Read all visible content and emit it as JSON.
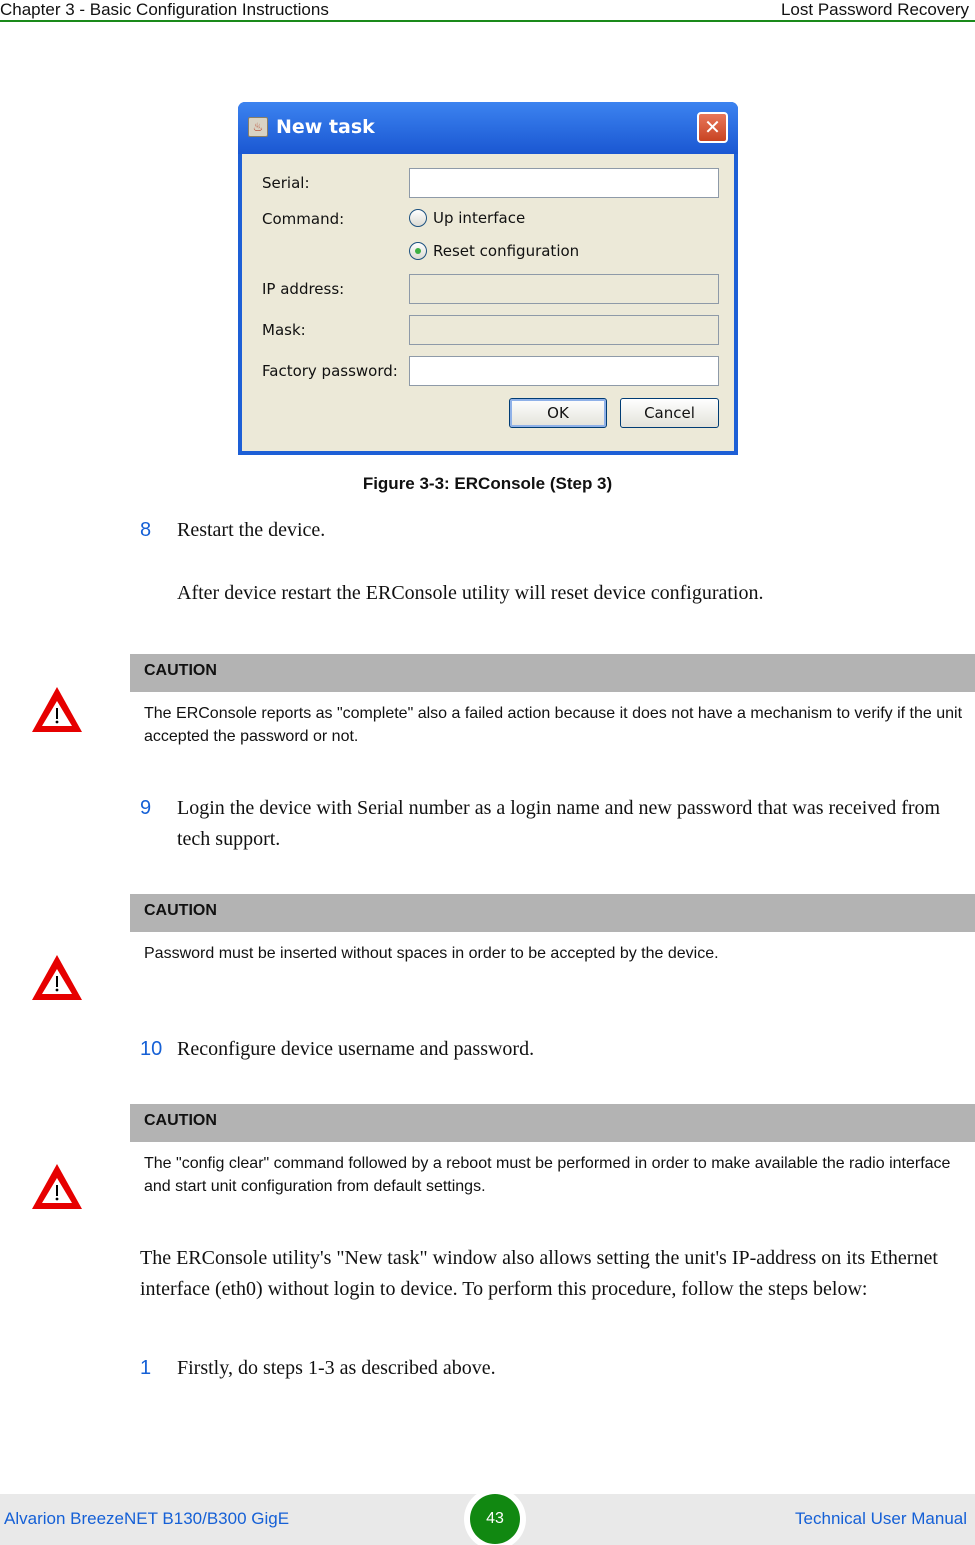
{
  "header": {
    "chapter": "Chapter 3 - Basic Configuration Instructions",
    "section": "Lost Password Recovery"
  },
  "dialog": {
    "title": "New task",
    "close_glyph": "✕",
    "app_icon_glyph": "♨",
    "fields": {
      "serial_label": "Serial:",
      "serial_value": "",
      "command_label": "Command:",
      "ip_label": "IP address:",
      "ip_value": "",
      "mask_label": "Mask:",
      "mask_value": "",
      "factory_password_label": "Factory password:",
      "factory_password_value": ""
    },
    "command_options": [
      {
        "label": "Up interface",
        "selected": false
      },
      {
        "label": "Reset configuration",
        "selected": true
      }
    ],
    "buttons": {
      "ok": "OK",
      "cancel": "Cancel"
    }
  },
  "figure_caption": "Figure 3-3: ERConsole (Step 3)",
  "steps": [
    {
      "num": "8",
      "text": "Restart the device."
    },
    {
      "num": "",
      "text": "After device restart the ERConsole utility will reset device configuration."
    },
    {
      "num": "9",
      "text": "Login the device with Serial number as a login name and new password that was received from tech support."
    },
    {
      "num": "10",
      "text": "Reconfigure device username and password."
    }
  ],
  "cautions": [
    {
      "title": "CAUTION",
      "text": "The ERConsole reports as \"complete\" also a failed action because it does not have a mechanism to verify if the unit accepted the password or not."
    },
    {
      "title": "CAUTION",
      "text": "Password must be inserted without spaces in order to be accepted by the device."
    },
    {
      "title": "CAUTION",
      "text": "The \"config clear\" command followed by a reboot must be performed in order to make available the radio interface and start unit configuration from default settings."
    }
  ],
  "paragraph": "The ERConsole utility's \"New task\" window also allows setting the unit's IP-address on its Ethernet interface (eth0) without login to device. To perform this procedure, follow the steps below:",
  "final_step": {
    "num": "1",
    "text": "Firstly, do steps 1-3 as described above."
  },
  "footer": {
    "product": "Alvarion BreezeNET B130/B300 GigE",
    "page": "43",
    "doc": "Technical User Manual"
  },
  "colors": {
    "accent_green": "#1a8a1a",
    "link_blue": "#1560d6",
    "warning_red": "#e60000"
  }
}
